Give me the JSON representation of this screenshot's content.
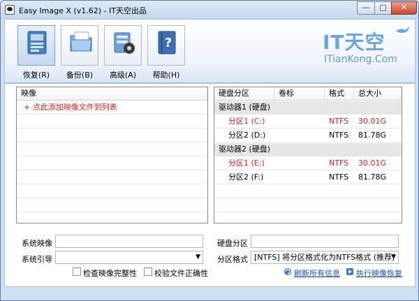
{
  "window": {
    "title": "Easy Image X (v1.62) - IT天空出品",
    "minimize": "—",
    "maximize": "□",
    "close": "✕"
  },
  "toolbar": {
    "items": [
      {
        "label": "恢复(R)",
        "icon": "restore-icon"
      },
      {
        "label": "备份(B)",
        "icon": "backup-folder-icon"
      },
      {
        "label": "高级(A)",
        "icon": "advanced-gear-icon"
      },
      {
        "label": "帮助(H)",
        "icon": "help-book-icon"
      }
    ]
  },
  "logo": {
    "main": "IT天空",
    "sub": "ITianKong.Com"
  },
  "image_list": {
    "header": "映像",
    "add_prompt": "+ 点此添加映像文件到列表"
  },
  "partitions": {
    "headers": [
      "硬盘分区",
      "卷标",
      "格式",
      "总大小"
    ],
    "rows": [
      {
        "type": "drive",
        "name": "驱动器1 (硬盘)"
      },
      {
        "type": "part",
        "name": "分区1 (C:)",
        "label": "",
        "fs": "NTFS",
        "size": "30.01G",
        "highlight": true
      },
      {
        "type": "part",
        "name": "分区2 (D:)",
        "label": "",
        "fs": "NTFS",
        "size": "81.78G",
        "highlight": false
      },
      {
        "type": "drive",
        "name": "驱动器2 (硬盘)"
      },
      {
        "type": "part",
        "name": "分区1 (E:)",
        "label": "",
        "fs": "NTFS",
        "size": "30.01G",
        "highlight": true
      },
      {
        "type": "part",
        "name": "分区2 (F:)",
        "label": "",
        "fs": "NTFS",
        "size": "81.78G",
        "highlight": false
      }
    ]
  },
  "form": {
    "system_image_label": "系统映像",
    "system_image_value": "",
    "system_boot_label": "系统引导",
    "system_boot_value": "",
    "check_image_label": "检查映像完整性",
    "check_files_label": "校验文件正确性",
    "disk_partition_label": "硬盘分区",
    "disk_partition_value": "",
    "partition_format_label": "分区格式",
    "partition_format_value": "[NTFS] 将分区格式化为NTFS格式 (推荐)",
    "refresh_link": "刷新所有信息",
    "execute_link": "执行映像恢复"
  },
  "colors": {
    "accent": "#6aa6dd",
    "highlight_text": "#e0201a",
    "link": "#1a4fb8"
  }
}
